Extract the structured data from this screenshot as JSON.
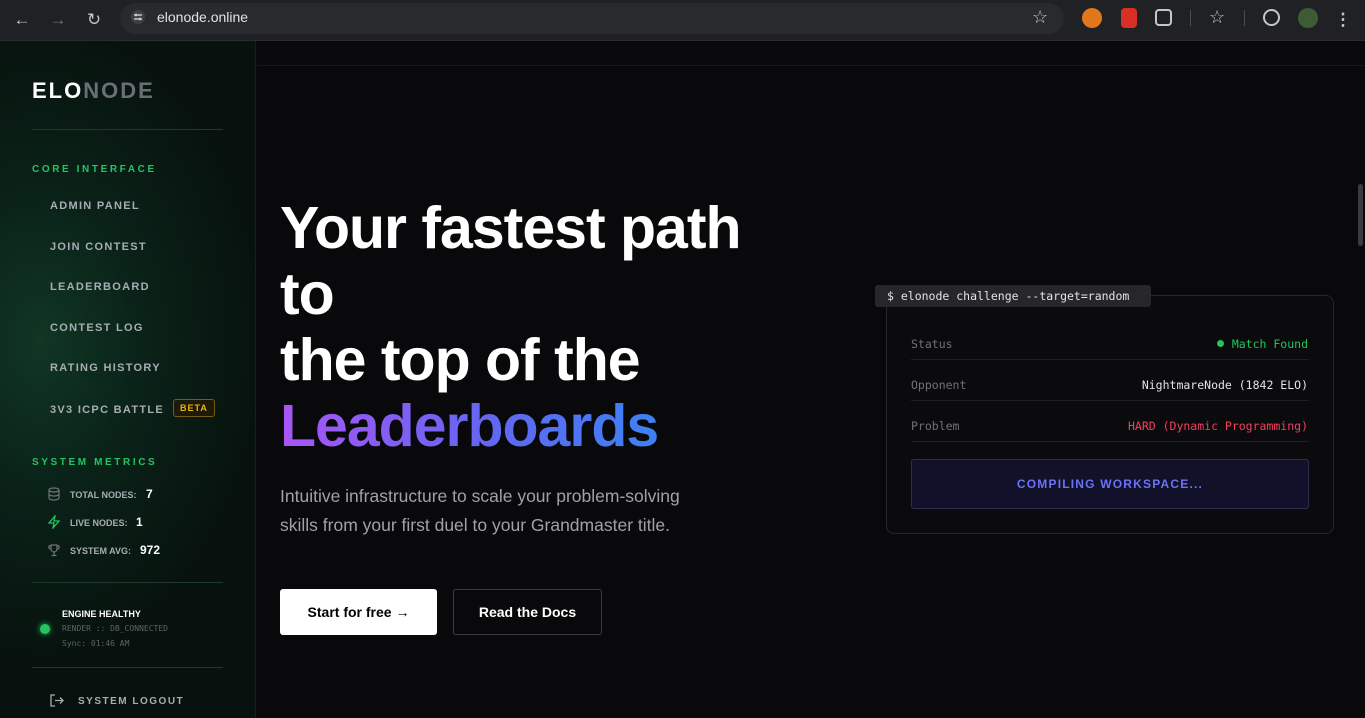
{
  "browser": {
    "url": "elonode.online",
    "back_icon": "←",
    "forward_icon": "→",
    "reload_icon": "↻",
    "star_icon": "☆"
  },
  "sidebar": {
    "logo_bright": "ELO",
    "logo_dim": "NODE",
    "core_title": "CORE INTERFACE",
    "nav": [
      "ADMIN PANEL",
      "JOIN CONTEST",
      "LEADERBOARD",
      "CONTEST LOG",
      "RATING HISTORY",
      "3V3 ICPC BATTLE"
    ],
    "beta": "BETA",
    "metrics_title": "SYSTEM METRICS",
    "metrics": [
      {
        "label": "TOTAL NODES:",
        "value": "7",
        "icon": "database-icon"
      },
      {
        "label": "LIVE NODES:",
        "value": "1",
        "icon": "bolt-icon"
      },
      {
        "label": "SYSTEM AVG:",
        "value": "972",
        "icon": "trophy-icon"
      }
    ],
    "engine": {
      "title": "ENGINE HEALTHY",
      "status": "RENDER :: DB_CONNECTED",
      "sync": "Sync: 01:46 AM"
    },
    "logout": "SYSTEM LOGOUT"
  },
  "hero": {
    "line1": "Your fastest path",
    "line2": "to",
    "line3": "the top of the",
    "line4": "Leaderboards",
    "subtitle1": "Intuitive infrastructure to scale your problem-solving",
    "subtitle2": "skills from your first duel to your Grandmaster title.",
    "primary_cta": "Start for free →",
    "secondary_cta": "Read the Docs"
  },
  "terminal": {
    "command": "$ elonode challenge --target=random",
    "rows": [
      {
        "label": "Status",
        "value": "Match Found"
      },
      {
        "label": "Opponent",
        "value": "NightmareNode (1842 ELO)"
      },
      {
        "label": "Problem",
        "value": "HARD (Dynamic Programming)"
      }
    ],
    "action": "COMPILING WORKSPACE..."
  },
  "colors": {
    "accent_green": "#22c55e",
    "danger": "#f43f5e",
    "beta": "#eab308",
    "compile": "#6c72f5"
  }
}
